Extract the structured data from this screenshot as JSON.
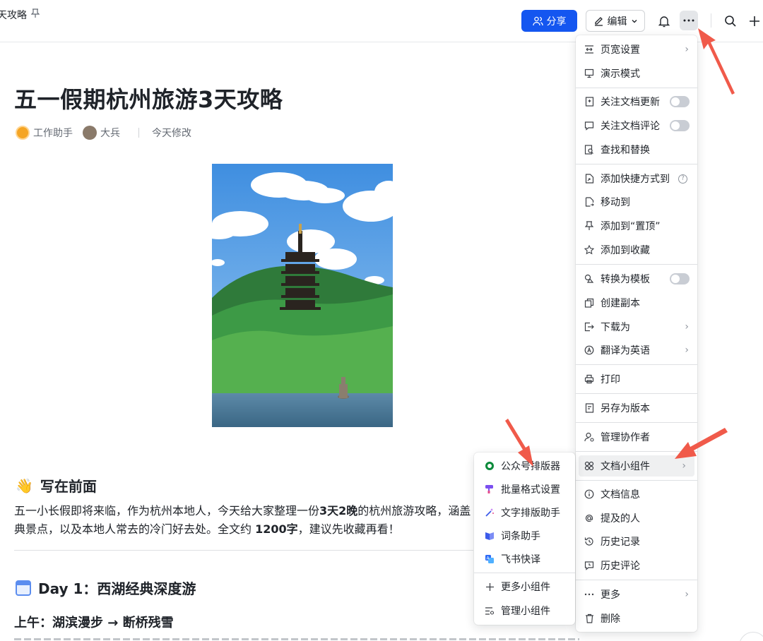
{
  "header": {
    "tab_title": "天攻略",
    "share_label": "分享",
    "edit_label": "编辑"
  },
  "doc": {
    "title": "五一假期杭州旅游3天攻略",
    "author1": "工作助手",
    "author2": "大兵",
    "modified": "今天修改",
    "intro_heading": "写在前面",
    "intro_para_1": "五一小长假即将来临，作为杭州本地人，今天给大家整理一份",
    "intro_para_bold1": "3天2晚",
    "intro_para_2": "的杭州旅游攻略，涵盖",
    "intro_para_3": "典景点，以及本地人常去的冷门好去处。全文约 ",
    "intro_para_bold2": "1200字",
    "intro_para_4": "，建议先收藏再看！",
    "day1_heading": "Day 1：西湖经典深度游",
    "morning_heading": "上午：湖滨漫步 → 断桥残雪"
  },
  "menu": {
    "page_width": "页宽设置",
    "present": "演示模式",
    "follow_updates": "关注文档更新",
    "follow_comments": "关注文档评论",
    "find_replace": "查找和替换",
    "add_shortcut": "添加快捷方式到",
    "move_to": "移动到",
    "pin": "添加到“置顶”",
    "favorite": "添加到收藏",
    "to_template": "转换为模板",
    "duplicate": "创建副本",
    "download": "下载为",
    "translate": "翻译为英语",
    "print": "打印",
    "save_version": "另存为版本",
    "collaborators": "管理协作者",
    "widgets": "文档小组件",
    "doc_info": "文档信息",
    "mentioned": "提及的人",
    "history": "历史记录",
    "history_comments": "历史评论",
    "more": "更多",
    "delete": "删除"
  },
  "submenu": {
    "wechat_formatter": "公众号排版器",
    "batch_format": "批量格式设置",
    "text_layout": "文字排版助手",
    "glossary": "词条助手",
    "quick_translate": "飞书快译",
    "more_widgets": "更多小组件",
    "manage_widgets": "管理小组件"
  },
  "colors": {
    "accent": "#1456f0",
    "annotation_arrow": "#f05a4a"
  }
}
